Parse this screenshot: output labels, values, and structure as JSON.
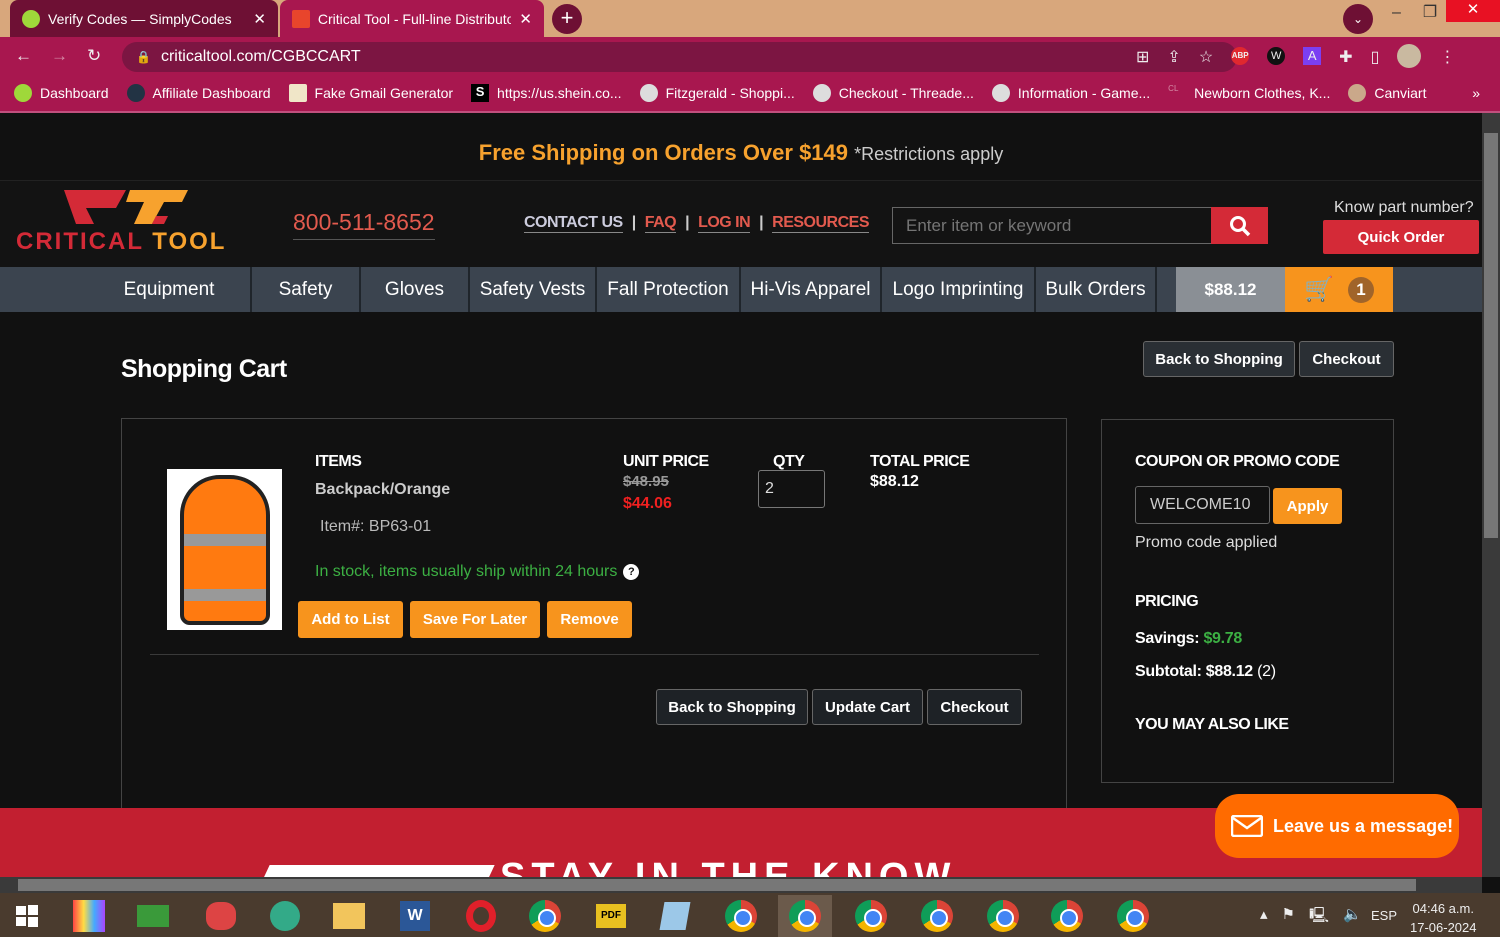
{
  "browser": {
    "tabs": [
      {
        "title": "Verify Codes — SimplyCodes"
      },
      {
        "title": "Critical Tool - Full-line Distributor"
      }
    ],
    "url": "criticaltool.com/CGBCCART",
    "bookmarks": [
      "Dashboard",
      "Affiliate Dashboard",
      "Fake Gmail Generator",
      "https://us.shein.co...",
      "Fitzgerald - Shoppi...",
      "Checkout - Threade...",
      "Information - Game...",
      "Newborn Clothes, K...",
      "Canviart"
    ],
    "more": "»"
  },
  "promo": {
    "main": "Free Shipping on Orders Over $149",
    "note": "*Restrictions apply"
  },
  "header": {
    "logo_a": "CRITICAL",
    "logo_b": "TOOL",
    "phone": "800-511-8652",
    "links": [
      "CONTACT US",
      "FAQ",
      "LOG IN",
      "RESOURCES"
    ],
    "search_placeholder": "Enter item or keyword",
    "know_part": "Know part number?",
    "quick_order": "Quick Order"
  },
  "nav": {
    "items": [
      "Equipment",
      "Safety",
      "Gloves",
      "Safety Vests",
      "Fall Protection",
      "Hi-Vis Apparel",
      "Logo Imprinting",
      "Bulk Orders"
    ],
    "cart_total": "$88.12",
    "cart_count": "1"
  },
  "cart": {
    "title": "Shopping Cart",
    "back": "Back to Shopping",
    "checkout": "Checkout",
    "update": "Update Cart",
    "headers": {
      "items": "ITEMS",
      "unit": "UNIT PRICE",
      "qty": "QTY",
      "total": "TOTAL PRICE"
    },
    "item": {
      "name": "Backpack/Orange",
      "sku": "Item#: BP63-01",
      "old_price": "$48.95",
      "price": "$44.06",
      "qty": "2",
      "total": "$88.12",
      "stock": "In stock, items usually ship within 24 hours"
    },
    "actions": [
      "Add to List",
      "Save For Later",
      "Remove"
    ]
  },
  "sidebar": {
    "coupon_title": "COUPON OR PROMO CODE",
    "coupon_value": "WELCOME10",
    "apply": "Apply",
    "applied": "Promo code applied",
    "pricing": "PRICING",
    "savings_label": "Savings:",
    "savings": "$9.78",
    "subtotal_label": "Subtotal: $88.12",
    "subtotal_count": "(2)",
    "also_like": "YOU MAY ALSO LIKE"
  },
  "footer": {
    "stay": "STAY IN THE KNOW"
  },
  "chat": {
    "label": "Leave us a message!"
  },
  "taskbar": {
    "lang": "ESP",
    "time": "04:46 a.m.",
    "date": "17-06-2024"
  }
}
